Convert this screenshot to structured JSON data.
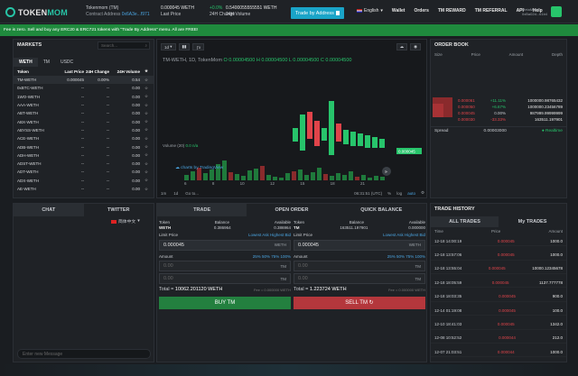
{
  "header": {
    "logo_prefix": "TOKEN",
    "logo_suffix": "MOM",
    "pair_name": "Tokenmom (TM)",
    "contract_label": "Contract Address",
    "contract_value": "0x6A3e...f971",
    "last_price_value": "0.000045 WETH",
    "last_price_label": "Last Price",
    "change_value": "+0.0%",
    "change_label": "24H Change",
    "volume_value": "0.5400055555551 WETH",
    "volume_label": "24H Volume",
    "trade_by_address": "Trade by Address",
    "language": "English",
    "nav": [
      "Wallet",
      "Orders",
      "TM REWARD",
      "TM REFERRAL",
      "API",
      "Help"
    ],
    "meta_line1": "MetaMask",
    "meta_line2": "0xBa02d...61b4"
  },
  "banner": {
    "text": "Fee is zero. Sell and buy any ERC20 & ERC721 tokens with \"Trade By Address\" menu. All are FREE!"
  },
  "markets": {
    "title": "MARKETS",
    "search_placeholder": "Search...",
    "tabs": [
      "WETH",
      "TM",
      "USDC"
    ],
    "columns": [
      "Token",
      "Last Price",
      "24H Change",
      "24H Volume"
    ],
    "rows": [
      {
        "token": "TM-WETH",
        "price": "0.000045",
        "change": "0.00%",
        "volume": "0.54"
      },
      {
        "token": "0xBTC-WETH",
        "price": "--",
        "change": "--",
        "volume": "0.00"
      },
      {
        "token": "1WO-WETH",
        "price": "--",
        "change": "--",
        "volume": "0.00"
      },
      {
        "token": "AAA-WETH",
        "price": "--",
        "change": "--",
        "volume": "0.00"
      },
      {
        "token": "ABT-WETH",
        "price": "--",
        "change": "--",
        "volume": "0.00"
      },
      {
        "token": "ABX-WETH",
        "price": "--",
        "change": "--",
        "volume": "0.00"
      },
      {
        "token": "ABYSS-WETH",
        "price": "--",
        "change": "--",
        "volume": "0.00"
      },
      {
        "token": "ACE-WETH",
        "price": "--",
        "change": "--",
        "volume": "0.00"
      },
      {
        "token": "ADB-WETH",
        "price": "--",
        "change": "--",
        "volume": "0.00"
      },
      {
        "token": "ADH-WETH",
        "price": "--",
        "change": "--",
        "volume": "0.00"
      },
      {
        "token": "ADST-WETH",
        "price": "--",
        "change": "--",
        "volume": "0.00"
      },
      {
        "token": "ADT-WETH",
        "price": "--",
        "change": "--",
        "volume": "0.00"
      },
      {
        "token": "ADX-WETH",
        "price": "--",
        "change": "--",
        "volume": "0.00"
      },
      {
        "token": "AE-WETH",
        "price": "--",
        "change": "--",
        "volume": "0.00"
      }
    ]
  },
  "chart": {
    "interval": "1d",
    "symbol_label": "TM-WETH, 1D, TokenMom",
    "ohlc": "O 0.00004500  H 0.00004500  L 0.00004500  C 0.00004500",
    "volume_label": "Volume (20)",
    "volume_value": "0.0  n/a",
    "tv_label": "charts by TradingView",
    "price_tag": "0.000045",
    "x_ticks": [
      "6",
      "8",
      "10",
      "12",
      "15",
      "18",
      "21"
    ],
    "ranges": [
      "1m",
      "1d",
      "Go to..."
    ],
    "time_readout": "06:31:51 (UTC)",
    "scale_opts": [
      "%",
      "log",
      "auto"
    ]
  },
  "orderbook": {
    "title": "ORDER BOOK",
    "columns": [
      "Size",
      "Price",
      "Amount",
      "Depth"
    ],
    "asks": [
      {
        "price": "0.000061",
        "change": "+11.11%",
        "amount": "1000000.98765432"
      },
      {
        "price": "0.000050",
        "change": "+6.67%",
        "amount": "1000000.23456789"
      },
      {
        "price": "0.000045",
        "change": "0.00%",
        "amount": "987999.99999999"
      },
      {
        "price": "0.000030",
        "change": "-33.33%",
        "amount": "163511.197901"
      }
    ],
    "spread_label": "Spread",
    "spread_value": "0.00003000",
    "realtime": "Realtime"
  },
  "chat": {
    "tabs": [
      "CHAT",
      "TWITTER"
    ],
    "language": "简体中文",
    "input_placeholder": "Enter new Message"
  },
  "trade": {
    "tabs": [
      "TRADE",
      "OPEN ORDER",
      "QUICK BALANCE"
    ],
    "buy": {
      "token_label": "Token",
      "token": "WETH",
      "balance_label": "Balance",
      "balance": "0.386964",
      "available_label": "Available",
      "available": "0.386964",
      "limit_label": "Limit Price",
      "links": "Lowest Ask  Highest Bid",
      "price": "0.000045",
      "price_unit": "WETH",
      "amount_label": "Amount",
      "pct": "25%  50%  75%  100%",
      "amount_placeholder": "0.00",
      "amount_unit": "TM",
      "total_placeholder": "0.00",
      "total_unit": "TM",
      "total_label": "Total =",
      "total_value": "10062.201120 WETH",
      "fee": "Fee = 0.000000 WETH",
      "button": "BUY TM"
    },
    "sell": {
      "token_label": "Token",
      "token": "TM",
      "balance_label": "Balance",
      "balance": "163511.197901",
      "available_label": "Available",
      "available": "0.000000",
      "limit_label": "Limit Price",
      "links": "Lowest Ask  Highest Bid",
      "price": "0.000045",
      "price_unit": "WETH",
      "amount_label": "Amount",
      "pct": "25%  50%  75%  100%",
      "amount_placeholder": "0.00",
      "amount_unit": "TM",
      "total_placeholder": "0.00",
      "total_unit": "TM",
      "total_label": "Total =",
      "total_value": "1.223724 WETH",
      "fee": "Fee = 0.000000 WETH",
      "button": "SELL TM"
    }
  },
  "history": {
    "title": "TRADE HISTORY",
    "tabs": [
      "ALL TRADES",
      "My TRADES"
    ],
    "columns": [
      "Time",
      "Price",
      "Amount"
    ],
    "rows": [
      {
        "time": "12-18 14:00:19",
        "price": "0.000045",
        "amount": "1000.0"
      },
      {
        "time": "12-18 13:57:06",
        "price": "0.000045",
        "amount": "1000.0"
      },
      {
        "time": "12-18 13:55:04",
        "price": "0.000045",
        "amount": "10000.12345678"
      },
      {
        "time": "12-18 18:05:59",
        "price": "0.000045",
        "amount": "1137.777778"
      },
      {
        "time": "12-18 18:03:35",
        "price": "0.000045",
        "amount": "900.0"
      },
      {
        "time": "12-14 01:19:08",
        "price": "0.000045",
        "amount": "100.0"
      },
      {
        "time": "12-10 18:41:03",
        "price": "0.000045",
        "amount": "1342.0"
      },
      {
        "time": "12-08 10:52:52",
        "price": "0.000044",
        "amount": "212.0"
      },
      {
        "time": "12-07 21:03:51",
        "price": "0.000044",
        "amount": "1000.0"
      }
    ]
  }
}
